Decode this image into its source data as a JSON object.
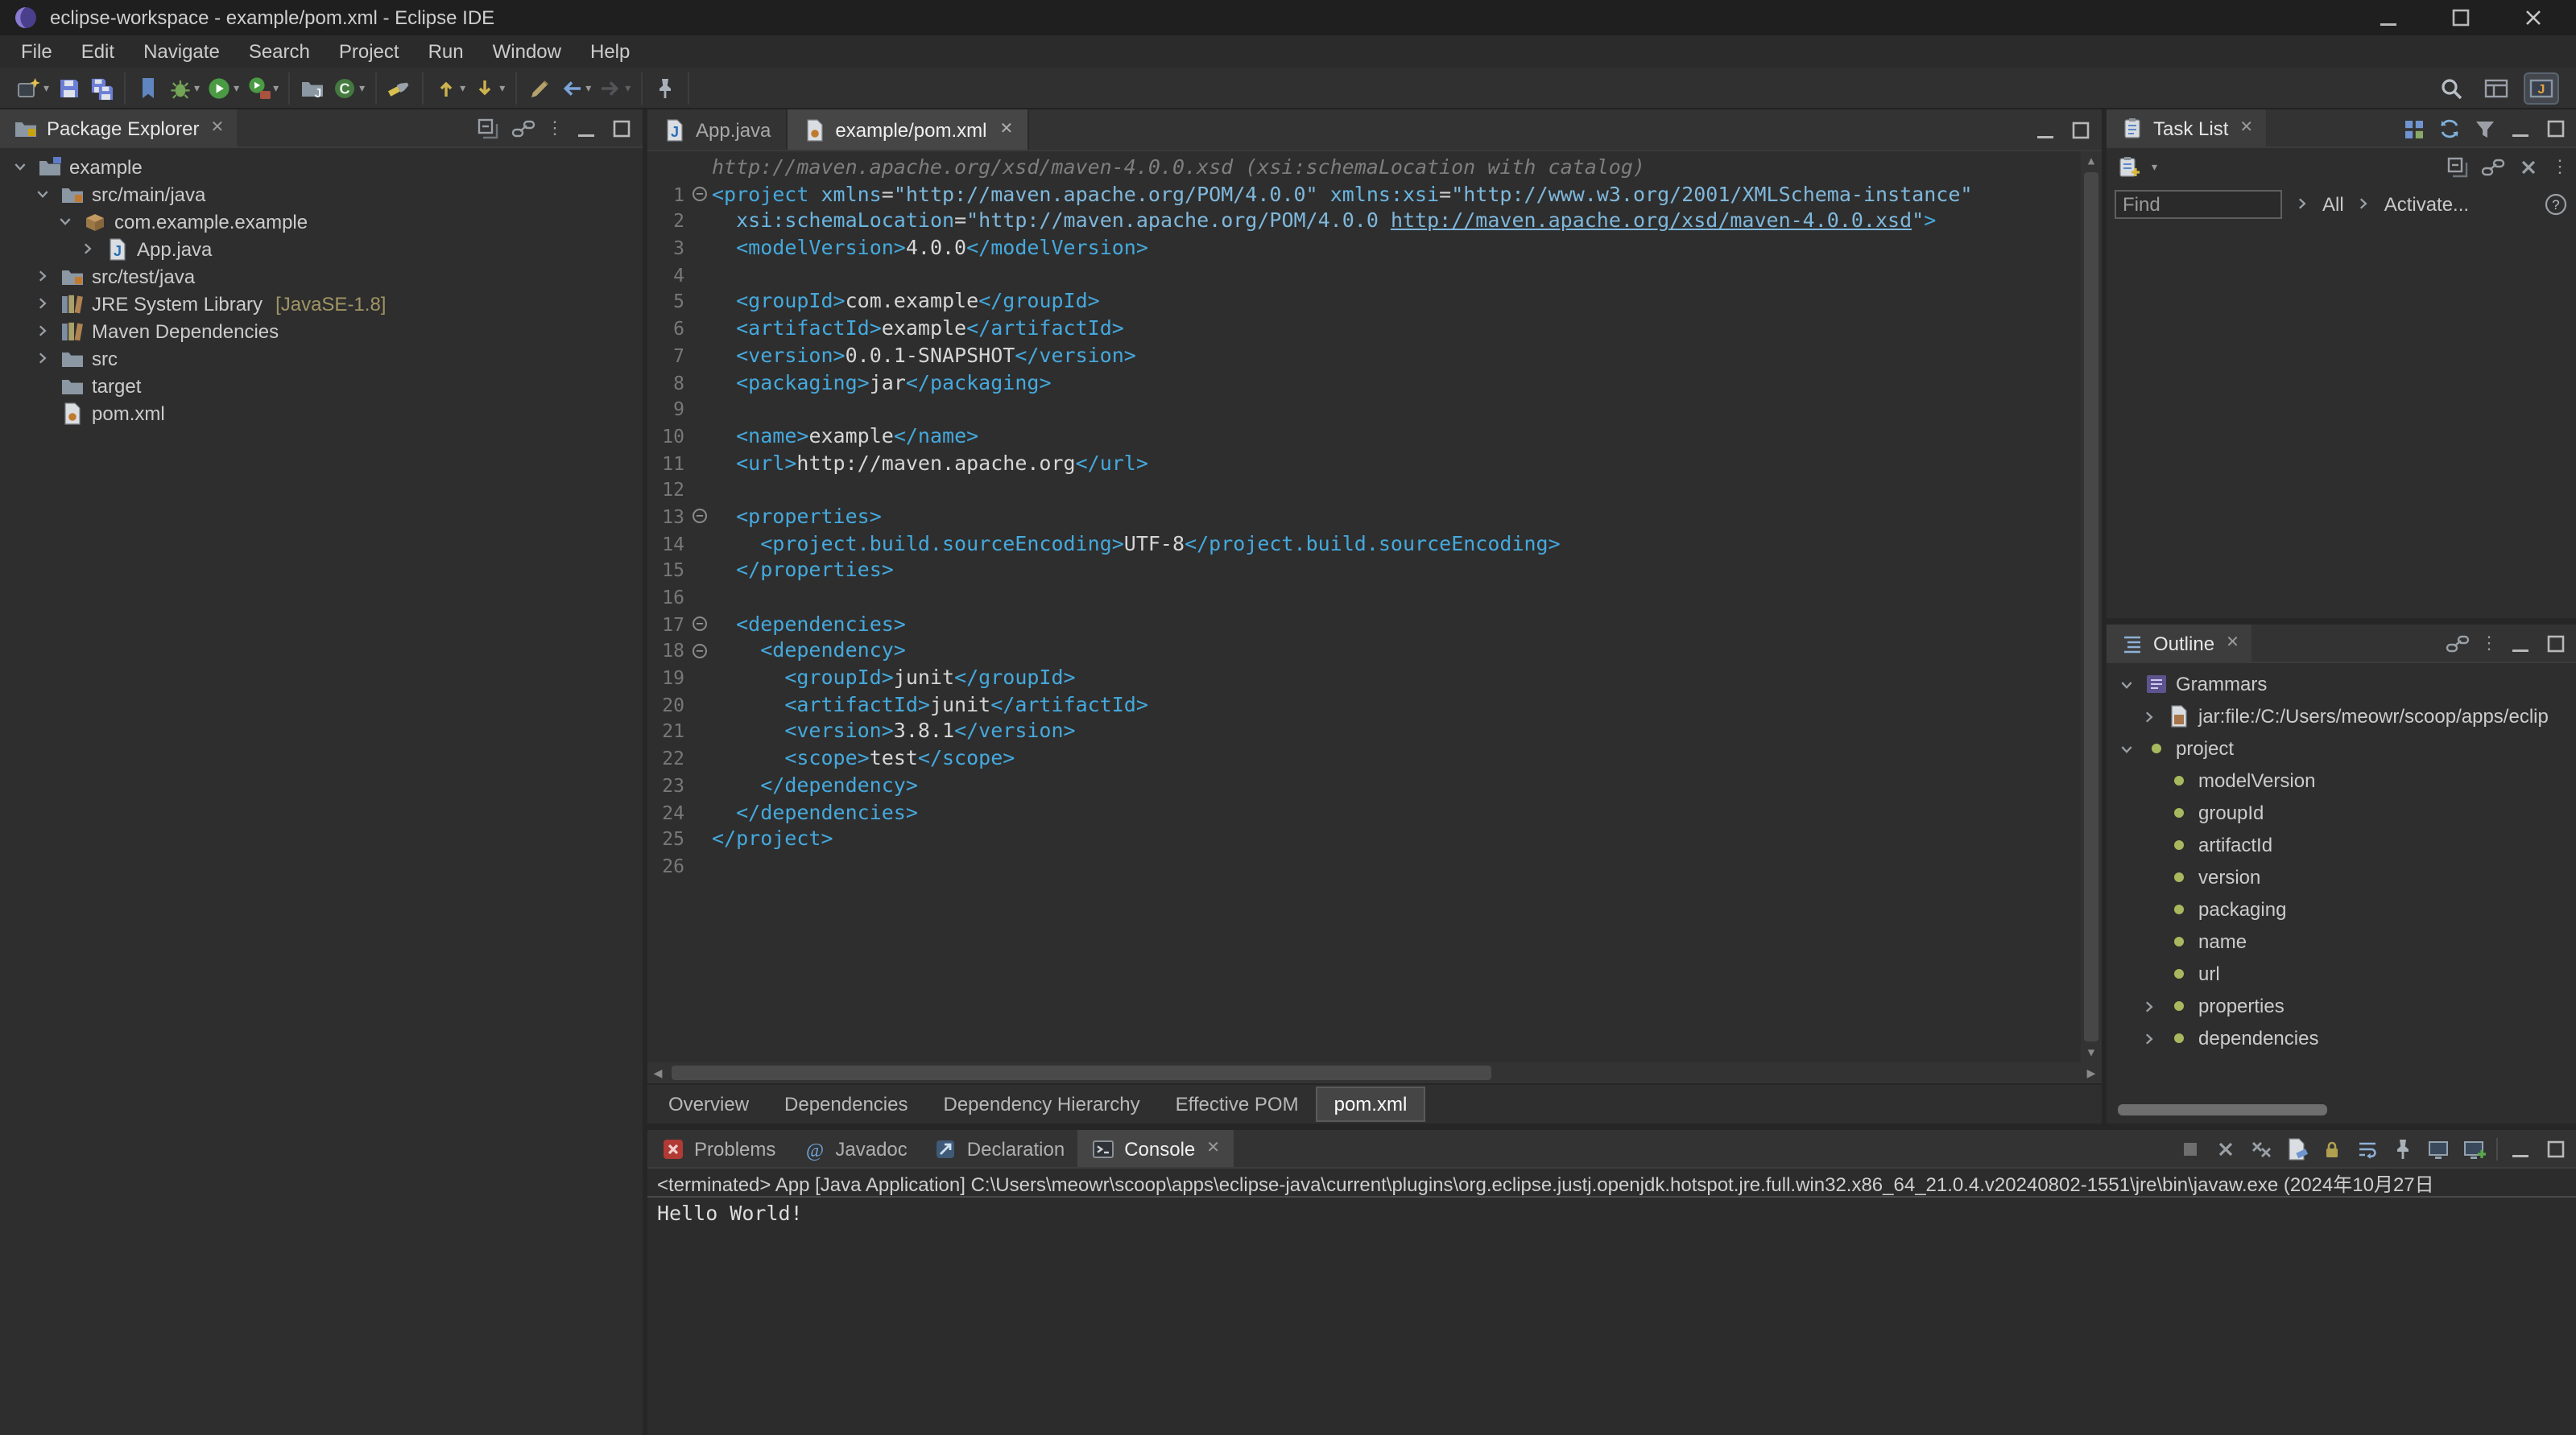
{
  "titlebar": {
    "title": "eclipse-workspace - example/pom.xml - Eclipse IDE"
  },
  "menubar": [
    "File",
    "Edit",
    "Navigate",
    "Search",
    "Project",
    "Run",
    "Window",
    "Help"
  ],
  "toolbar": {
    "groups": [
      [
        {
          "icon": "new-wizard",
          "dd": true
        },
        {
          "icon": "save"
        },
        {
          "icon": "save-all"
        }
      ],
      [
        {
          "icon": "skip-bp"
        },
        {
          "icon": "debug",
          "dd": true
        },
        {
          "icon": "run",
          "dd": true
        },
        {
          "icon": "ext-tools",
          "dd": true
        }
      ],
      [
        {
          "icon": "new-java-project"
        },
        {
          "icon": "new-class",
          "dd": true
        }
      ],
      [
        {
          "icon": "flashlight"
        }
      ],
      [
        {
          "icon": "prev-ann",
          "dd": true
        },
        {
          "icon": "next-ann",
          "dd": true
        }
      ],
      [
        {
          "icon": "last-edit"
        },
        {
          "icon": "back",
          "dd": true
        },
        {
          "icon": "forward",
          "dd": true,
          "disabled": true
        }
      ],
      [
        {
          "icon": "pin"
        }
      ]
    ],
    "right": [
      {
        "icon": "magnifier"
      },
      {
        "icon": "persp-grid"
      },
      {
        "icon": "persp-java",
        "active": true
      }
    ]
  },
  "package_explorer": {
    "title": "Package Explorer",
    "items": [
      {
        "indent": 0,
        "caret": "open",
        "icon": "project",
        "label": "example"
      },
      {
        "indent": 1,
        "caret": "open",
        "icon": "src-folder",
        "label": "src/main/java"
      },
      {
        "indent": 2,
        "caret": "open",
        "icon": "package",
        "label": "com.example.example"
      },
      {
        "indent": 3,
        "caret": "closed",
        "icon": "java-file",
        "label": "App.java"
      },
      {
        "indent": 1,
        "caret": "closed",
        "icon": "src-folder",
        "label": "src/test/java"
      },
      {
        "indent": 1,
        "caret": "closed",
        "icon": "library",
        "label": "JRE System Library",
        "suffix": "[JavaSE-1.8]"
      },
      {
        "indent": 1,
        "caret": "closed",
        "icon": "library",
        "label": "Maven Dependencies"
      },
      {
        "indent": 1,
        "caret": "closed",
        "icon": "folder",
        "label": "src"
      },
      {
        "indent": 1,
        "caret": null,
        "icon": "folder",
        "label": "target"
      },
      {
        "indent": 1,
        "caret": null,
        "icon": "pom-file",
        "label": "pom.xml"
      }
    ]
  },
  "editor": {
    "tabs": [
      {
        "icon": "java-file",
        "label": "App.java",
        "active": false
      },
      {
        "icon": "pom-file",
        "label": "example/pom.xml",
        "active": true,
        "closable": true
      }
    ],
    "mining": "http://maven.apache.org/xsd/maven-4.0.0.xsd (xsi:schemaLocation with catalog)",
    "lines": [
      {
        "n": 1,
        "fold": true,
        "tk": [
          [
            "g",
            "<project "
          ],
          [
            "a",
            "xmlns"
          ],
          [
            "p",
            "="
          ],
          [
            "s",
            "\"http://maven.apache.org/POM/4.0.0\""
          ],
          [
            "p",
            " "
          ],
          [
            "a",
            "xmlns:xsi"
          ],
          [
            "p",
            "="
          ],
          [
            "s",
            "\"http://www.w3.org/2001/XMLSchema-instance\""
          ]
        ]
      },
      {
        "n": 2,
        "tk": [
          [
            "p",
            "  "
          ],
          [
            "a",
            "xsi:schemaLocation"
          ],
          [
            "p",
            "="
          ],
          [
            "s",
            "\"http://maven.apache.org/POM/4.0.0 "
          ],
          [
            "l",
            "http://maven.apache.org/xsd/maven-4.0.0.xsd"
          ],
          [
            "s",
            "\""
          ],
          [
            "g",
            ">"
          ]
        ]
      },
      {
        "n": 3,
        "tk": [
          [
            "p",
            "  "
          ],
          [
            "g",
            "<modelVersion>"
          ],
          [
            "t",
            "4.0.0"
          ],
          [
            "g",
            "</modelVersion>"
          ]
        ]
      },
      {
        "n": 4,
        "tk": []
      },
      {
        "n": 5,
        "tk": [
          [
            "p",
            "  "
          ],
          [
            "g",
            "<groupId>"
          ],
          [
            "t",
            "com.example"
          ],
          [
            "g",
            "</groupId>"
          ]
        ]
      },
      {
        "n": 6,
        "tk": [
          [
            "p",
            "  "
          ],
          [
            "g",
            "<artifactId>"
          ],
          [
            "t",
            "example"
          ],
          [
            "g",
            "</artifactId>"
          ]
        ]
      },
      {
        "n": 7,
        "tk": [
          [
            "p",
            "  "
          ],
          [
            "g",
            "<version>"
          ],
          [
            "t",
            "0.0.1-SNAPSHOT"
          ],
          [
            "g",
            "</version>"
          ]
        ]
      },
      {
        "n": 8,
        "tk": [
          [
            "p",
            "  "
          ],
          [
            "g",
            "<packaging>"
          ],
          [
            "t",
            "jar"
          ],
          [
            "g",
            "</packaging>"
          ]
        ]
      },
      {
        "n": 9,
        "tk": []
      },
      {
        "n": 10,
        "tk": [
          [
            "p",
            "  "
          ],
          [
            "g",
            "<name>"
          ],
          [
            "t",
            "example"
          ],
          [
            "g",
            "</name>"
          ]
        ]
      },
      {
        "n": 11,
        "tk": [
          [
            "p",
            "  "
          ],
          [
            "g",
            "<url>"
          ],
          [
            "t",
            "http://maven.apache.org"
          ],
          [
            "g",
            "</url>"
          ]
        ]
      },
      {
        "n": 12,
        "tk": []
      },
      {
        "n": 13,
        "fold": true,
        "tk": [
          [
            "p",
            "  "
          ],
          [
            "g",
            "<properties>"
          ]
        ]
      },
      {
        "n": 14,
        "tk": [
          [
            "p",
            "    "
          ],
          [
            "g",
            "<project.build.sourceEncoding>"
          ],
          [
            "t",
            "UTF-8"
          ],
          [
            "g",
            "</project.build.sourceEncoding>"
          ]
        ]
      },
      {
        "n": 15,
        "tk": [
          [
            "p",
            "  "
          ],
          [
            "g",
            "</properties>"
          ]
        ]
      },
      {
        "n": 16,
        "tk": []
      },
      {
        "n": 17,
        "fold": true,
        "tk": [
          [
            "p",
            "  "
          ],
          [
            "g",
            "<dependencies>"
          ]
        ]
      },
      {
        "n": 18,
        "fold": true,
        "tk": [
          [
            "p",
            "    "
          ],
          [
            "g",
            "<dependency>"
          ]
        ]
      },
      {
        "n": 19,
        "tk": [
          [
            "p",
            "      "
          ],
          [
            "g",
            "<groupId>"
          ],
          [
            "t",
            "junit"
          ],
          [
            "g",
            "</groupId>"
          ]
        ]
      },
      {
        "n": 20,
        "tk": [
          [
            "p",
            "      "
          ],
          [
            "g",
            "<artifactId>"
          ],
          [
            "t",
            "junit"
          ],
          [
            "g",
            "</artifactId>"
          ]
        ]
      },
      {
        "n": 21,
        "tk": [
          [
            "p",
            "      "
          ],
          [
            "g",
            "<version>"
          ],
          [
            "t",
            "3.8.1"
          ],
          [
            "g",
            "</version>"
          ]
        ]
      },
      {
        "n": 22,
        "tk": [
          [
            "p",
            "      "
          ],
          [
            "g",
            "<scope>"
          ],
          [
            "t",
            "test"
          ],
          [
            "g",
            "</scope>"
          ]
        ]
      },
      {
        "n": 23,
        "tk": [
          [
            "p",
            "    "
          ],
          [
            "g",
            "</dependency>"
          ]
        ]
      },
      {
        "n": 24,
        "tk": [
          [
            "p",
            "  "
          ],
          [
            "g",
            "</dependencies>"
          ]
        ]
      },
      {
        "n": 25,
        "tk": [
          [
            "g",
            "</project>"
          ]
        ]
      },
      {
        "n": 26,
        "tk": []
      }
    ],
    "page_tabs": [
      {
        "label": "Overview"
      },
      {
        "label": "Dependencies"
      },
      {
        "label": "Dependency Hierarchy"
      },
      {
        "label": "Effective POM"
      },
      {
        "label": "pom.xml",
        "active": true
      }
    ]
  },
  "console": {
    "tabs": [
      {
        "icon": "problems",
        "label": "Problems"
      },
      {
        "icon": "javadoc",
        "label": "Javadoc"
      },
      {
        "icon": "declaration",
        "label": "Declaration"
      },
      {
        "icon": "console",
        "label": "Console",
        "active": true,
        "closable": true
      }
    ],
    "toolbar": [
      "terminate",
      "remove",
      "remove-all",
      "clear",
      "scroll-lock",
      "word-wrap",
      "pin",
      "display-selected",
      "open-console"
    ],
    "status": "<terminated> App [Java Application] C:\\Users\\meowr\\scoop\\apps\\eclipse-java\\current\\plugins\\org.eclipse.justj.openjdk.hotspot.jre.full.win32.x86_64_21.0.4.v20240802-1551\\jre\\bin\\javaw.exe (2024年10月27日",
    "output": "Hello World!"
  },
  "task_list": {
    "title": "Task List",
    "find_placeholder": "Find",
    "all_label": "All",
    "activate_label": "Activate..."
  },
  "outline": {
    "title": "Outline",
    "items": [
      {
        "indent": 0,
        "caret": "open",
        "icon": "grammars",
        "label": "Grammars"
      },
      {
        "indent": 1,
        "caret": "closed",
        "icon": "jar",
        "label": "jar:file:/C:/Users/meowr/scoop/apps/eclip"
      },
      {
        "indent": 0,
        "caret": "open",
        "icon": "element",
        "label": "project"
      },
      {
        "indent": 1,
        "caret": null,
        "icon": "element",
        "label": "modelVersion"
      },
      {
        "indent": 1,
        "caret": null,
        "icon": "element",
        "label": "groupId"
      },
      {
        "indent": 1,
        "caret": null,
        "icon": "element",
        "label": "artifactId"
      },
      {
        "indent": 1,
        "caret": null,
        "icon": "element",
        "label": "version"
      },
      {
        "indent": 1,
        "caret": null,
        "icon": "element",
        "label": "packaging"
      },
      {
        "indent": 1,
        "caret": null,
        "icon": "element",
        "label": "name"
      },
      {
        "indent": 1,
        "caret": null,
        "icon": "element",
        "label": "url"
      },
      {
        "indent": 1,
        "caret": "closed",
        "icon": "element",
        "label": "properties"
      },
      {
        "indent": 1,
        "caret": "closed",
        "icon": "element",
        "label": "dependencies"
      }
    ]
  },
  "colors": {
    "xml_tag": "#45a9dd",
    "xml_attribute": "#6ab6e2",
    "xml_string": "#7fb8dc",
    "xml_text": "#d6d6d6",
    "editor_background": "#2e2e2e",
    "ui_background": "#2b2b2b"
  }
}
